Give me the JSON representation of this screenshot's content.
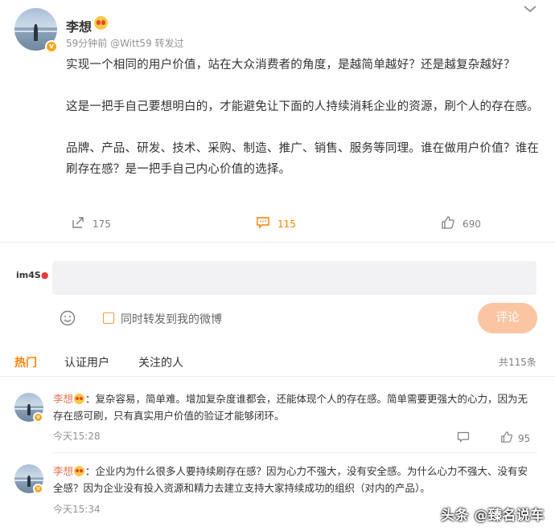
{
  "post": {
    "author": "李想",
    "meta": "59分钟前 @Witt59 转发过",
    "paragraphs": [
      "实现一个相同的用户价值，站在大众消费者的角度，是越简单越好？还是越复杂越好？",
      "这是一把手自己要想明白的，才能避免让下面的人持续消耗企业的资源，刷个人的存在感。",
      "品牌、产品、研发、技术、采购、制造、推广、销售、服务等同理。谁在做用户价值？谁在刷存在感？是一把手自己内心价值的选择。"
    ],
    "actions": {
      "repost_count": "175",
      "comment_count": "115",
      "like_count": "690"
    }
  },
  "composer": {
    "logo": "im4S",
    "forward_label": "同时转发到我的微博",
    "submit_label": "评论",
    "input_value": ""
  },
  "tabs": {
    "items": [
      "热门",
      "认证用户",
      "关注的人"
    ],
    "active": "热门",
    "total": "共115条"
  },
  "comments": [
    {
      "name": "李想",
      "text": "：复杂容易，简单难。增加复杂度谁都会，还能体现个人的存在感。简单需要更强大的心力，因为无存在感可刷，只有真实用户价值的验证才能够闭环。",
      "time": "今天15:28",
      "likes": "95"
    },
    {
      "name": "李想",
      "text": "：企业内为什么很多人要持续刷存在感？因为心力不强大，没有安全感。为什么心力不强大、没有安全感？因为企业没有投入资源和精力去建立支持大家持续成功的组织（对内的产品）。",
      "time": "今天15:34",
      "likes": ""
    }
  ],
  "watermark": "头条 @臻名说车",
  "colors": {
    "accent": "#ff8200",
    "name_link": "#eb7350",
    "submit_disabled": "#fbc5a3",
    "verified_badge": "#f5a623"
  },
  "icons": [
    "chevron-down-icon",
    "repost-icon",
    "comment-icon",
    "like-icon",
    "emoji-icon",
    "reply-icon"
  ]
}
